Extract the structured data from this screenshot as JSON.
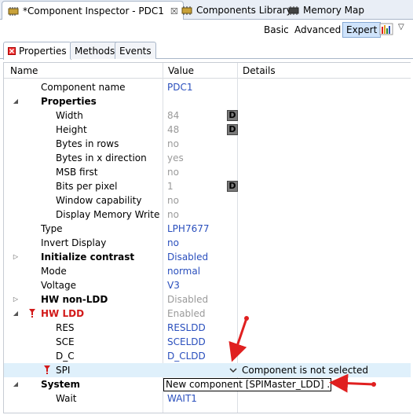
{
  "editor_tabs": [
    {
      "label": "*Component Inspector - PDC1",
      "close": "☒"
    },
    {
      "label": "Components Library"
    },
    {
      "label": "Memory Map"
    }
  ],
  "toolbar": {
    "basic": "Basic",
    "advanced": "Advanced",
    "expert": "Expert",
    "menu": "▽"
  },
  "inner_tabs": {
    "properties": "Properties",
    "methods": "Methods",
    "events": "Events"
  },
  "columns": {
    "name": "Name",
    "value": "Value",
    "details": "Details"
  },
  "rows": [
    {
      "name": "Component name",
      "value": "PDC1"
    },
    {
      "name": "Properties",
      "value": ""
    },
    {
      "name": "Width",
      "value": "84",
      "button": "D"
    },
    {
      "name": "Height",
      "value": "48",
      "button": "D"
    },
    {
      "name": "Bytes in rows",
      "value": "no"
    },
    {
      "name": "Bytes in x direction",
      "value": "yes"
    },
    {
      "name": "MSB first",
      "value": "no"
    },
    {
      "name": "Bits per pixel",
      "value": "1",
      "button": "D"
    },
    {
      "name": "Window capability",
      "value": "no"
    },
    {
      "name": "Display Memory Write",
      "value": "no"
    },
    {
      "name": "Type",
      "value": "LPH7677"
    },
    {
      "name": "Invert Display",
      "value": "no"
    },
    {
      "name": "Initialize contrast",
      "value": "Disabled"
    },
    {
      "name": "Mode",
      "value": "normal"
    },
    {
      "name": "Voltage",
      "value": "V3"
    },
    {
      "name": "HW non-LDD",
      "value": "Disabled"
    },
    {
      "name": "HW LDD",
      "value": "Enabled"
    },
    {
      "name": "RES",
      "value": "RESLDD"
    },
    {
      "name": "SCE",
      "value": "SCELDD"
    },
    {
      "name": "D_C",
      "value": "D_CLDD"
    },
    {
      "name": "SPI",
      "value": "",
      "details": "Component is not selected"
    },
    {
      "name": "System",
      "value": ""
    },
    {
      "name": "Wait",
      "value": "WAIT1"
    }
  ],
  "dropdown_option": "New component [SPIMaster_LDD] ...",
  "colors": {
    "accent_blue": "#2a4fbd",
    "error_red": "#d21a1a",
    "annotation_red": "#e02020",
    "selection": "#dff0fb"
  },
  "icons": [
    "component-inspector-icon",
    "components-library-icon",
    "memory-map-icon",
    "chart-icon",
    "properties-icon",
    "error-icon",
    "expand-icon",
    "collapse-icon",
    "dropdown-chevron-icon"
  ]
}
